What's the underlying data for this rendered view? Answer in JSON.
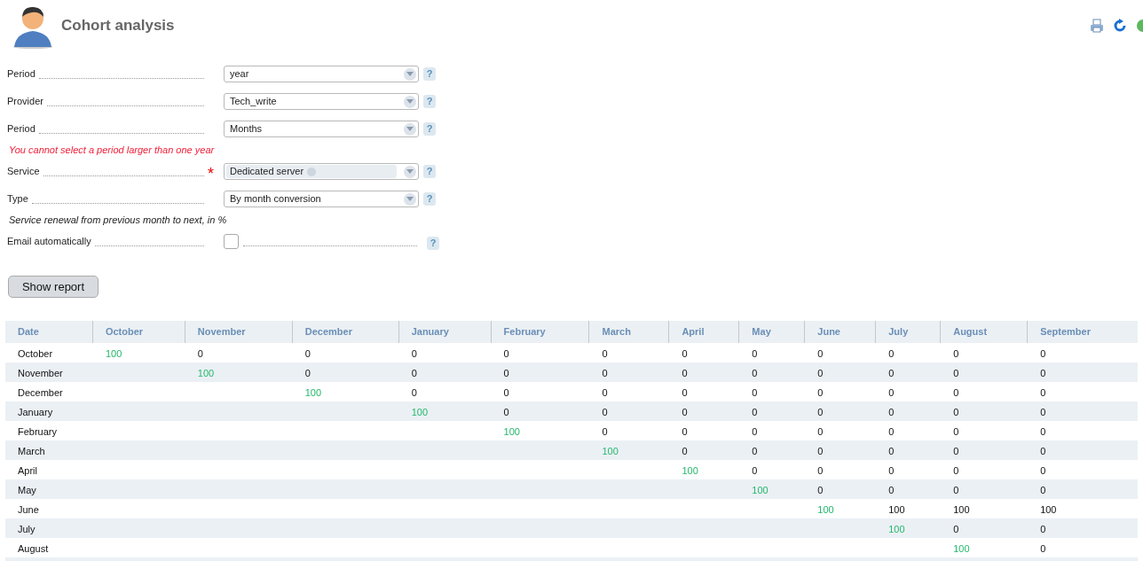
{
  "header": {
    "title": "Cohort analysis"
  },
  "form": {
    "fields": [
      {
        "kind": "select",
        "label": "Period",
        "value": "year"
      },
      {
        "kind": "select",
        "label": "Provider",
        "value": "Tech_write"
      },
      {
        "kind": "select",
        "label": "Period",
        "value": "Months"
      },
      {
        "kind": "error",
        "text": "You cannot select a period larger than one year"
      },
      {
        "kind": "tags",
        "label": "Service",
        "tags": [
          "Dedicated server"
        ],
        "required_mark": "*"
      },
      {
        "kind": "select",
        "label": "Type",
        "value": "By month conversion"
      },
      {
        "kind": "note",
        "text": "Service renewal from previous month to next, in %"
      },
      {
        "kind": "checkbox",
        "label": "Email automatically",
        "checked": false
      }
    ],
    "help": "?",
    "submit": "Show report"
  },
  "table": {
    "columns": [
      "Date",
      "October",
      "November",
      "December",
      "January",
      "February",
      "March",
      "April",
      "May",
      "June",
      "July",
      "August",
      "September"
    ],
    "rows": [
      [
        "October",
        {
          "value": "100",
          "highlighted": true
        },
        {
          "value": "0",
          "highlighted": false
        },
        {
          "value": "0",
          "highlighted": false
        },
        {
          "value": "0",
          "highlighted": false
        },
        {
          "value": "0",
          "highlighted": false
        },
        {
          "value": "0",
          "highlighted": false
        },
        {
          "value": "0",
          "highlighted": false
        },
        {
          "value": "0",
          "highlighted": false
        },
        {
          "value": "0",
          "highlighted": false
        },
        {
          "value": "0",
          "highlighted": false
        },
        {
          "value": "0",
          "highlighted": false
        },
        {
          "value": "0",
          "highlighted": false
        }
      ],
      [
        "November",
        "",
        {
          "value": "100",
          "highlighted": true
        },
        {
          "value": "0",
          "highlighted": false
        },
        {
          "value": "0",
          "highlighted": false
        },
        {
          "value": "0",
          "highlighted": false
        },
        {
          "value": "0",
          "highlighted": false
        },
        {
          "value": "0",
          "highlighted": false
        },
        {
          "value": "0",
          "highlighted": false
        },
        {
          "value": "0",
          "highlighted": false
        },
        {
          "value": "0",
          "highlighted": false
        },
        {
          "value": "0",
          "highlighted": false
        },
        {
          "value": "0",
          "highlighted": false
        }
      ],
      [
        "December",
        "",
        "",
        {
          "value": "100",
          "highlighted": true
        },
        {
          "value": "0",
          "highlighted": false
        },
        {
          "value": "0",
          "highlighted": false
        },
        {
          "value": "0",
          "highlighted": false
        },
        {
          "value": "0",
          "highlighted": false
        },
        {
          "value": "0",
          "highlighted": false
        },
        {
          "value": "0",
          "highlighted": false
        },
        {
          "value": "0",
          "highlighted": false
        },
        {
          "value": "0",
          "highlighted": false
        },
        {
          "value": "0",
          "highlighted": false
        }
      ],
      [
        "January",
        "",
        "",
        "",
        {
          "value": "100",
          "highlighted": true
        },
        {
          "value": "0",
          "highlighted": false
        },
        {
          "value": "0",
          "highlighted": false
        },
        {
          "value": "0",
          "highlighted": false
        },
        {
          "value": "0",
          "highlighted": false
        },
        {
          "value": "0",
          "highlighted": false
        },
        {
          "value": "0",
          "highlighted": false
        },
        {
          "value": "0",
          "highlighted": false
        },
        {
          "value": "0",
          "highlighted": false
        }
      ],
      [
        "February",
        "",
        "",
        "",
        "",
        {
          "value": "100",
          "highlighted": true
        },
        {
          "value": "0",
          "highlighted": false
        },
        {
          "value": "0",
          "highlighted": false
        },
        {
          "value": "0",
          "highlighted": false
        },
        {
          "value": "0",
          "highlighted": false
        },
        {
          "value": "0",
          "highlighted": false
        },
        {
          "value": "0",
          "highlighted": false
        },
        {
          "value": "0",
          "highlighted": false
        }
      ],
      [
        "March",
        "",
        "",
        "",
        "",
        "",
        {
          "value": "100",
          "highlighted": true
        },
        {
          "value": "0",
          "highlighted": false
        },
        {
          "value": "0",
          "highlighted": false
        },
        {
          "value": "0",
          "highlighted": false
        },
        {
          "value": "0",
          "highlighted": false
        },
        {
          "value": "0",
          "highlighted": false
        },
        {
          "value": "0",
          "highlighted": false
        }
      ],
      [
        "April",
        "",
        "",
        "",
        "",
        "",
        "",
        {
          "value": "100",
          "highlighted": true
        },
        {
          "value": "0",
          "highlighted": false
        },
        {
          "value": "0",
          "highlighted": false
        },
        {
          "value": "0",
          "highlighted": false
        },
        {
          "value": "0",
          "highlighted": false
        },
        {
          "value": "0",
          "highlighted": false
        }
      ],
      [
        "May",
        "",
        "",
        "",
        "",
        "",
        "",
        "",
        {
          "value": "100",
          "highlighted": true
        },
        {
          "value": "0",
          "highlighted": false
        },
        {
          "value": "0",
          "highlighted": false
        },
        {
          "value": "0",
          "highlighted": false
        },
        {
          "value": "0",
          "highlighted": false
        }
      ],
      [
        "June",
        "",
        "",
        "",
        "",
        "",
        "",
        "",
        "",
        {
          "value": "100",
          "highlighted": true
        },
        {
          "value": "100",
          "highlighted": false
        },
        {
          "value": "100",
          "highlighted": false
        },
        {
          "value": "100",
          "highlighted": false
        }
      ],
      [
        "July",
        "",
        "",
        "",
        "",
        "",
        "",
        "",
        "",
        "",
        {
          "value": "100",
          "highlighted": true
        },
        {
          "value": "0",
          "highlighted": false
        },
        {
          "value": "0",
          "highlighted": false
        }
      ],
      [
        "August",
        "",
        "",
        "",
        "",
        "",
        "",
        "",
        "",
        "",
        "",
        {
          "value": "100",
          "highlighted": true
        },
        {
          "value": "0",
          "highlighted": false
        }
      ]
    ]
  }
}
